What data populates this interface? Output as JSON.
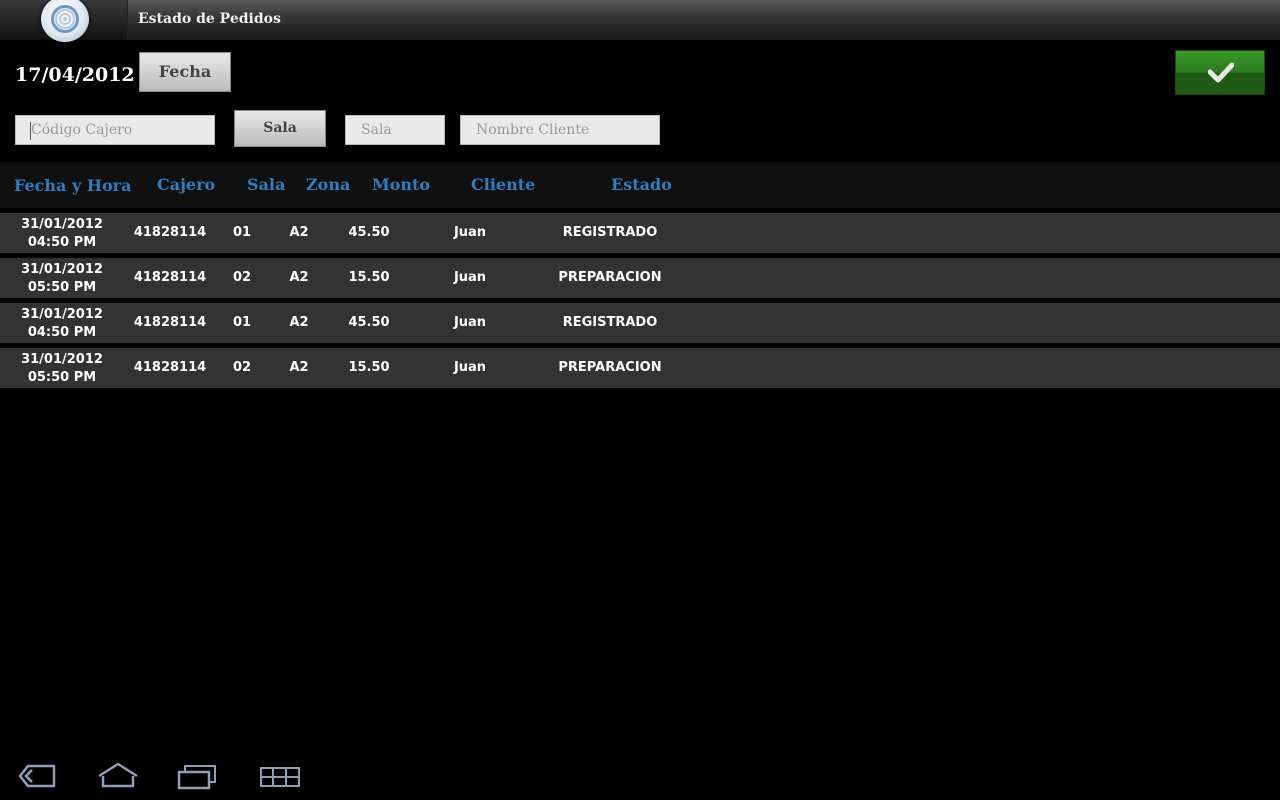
{
  "app": {
    "title": "Estado de Pedidos",
    "logo_icon": "app-logo-icon"
  },
  "filters": {
    "date_value": "17/04/2012",
    "fecha_button": "Fecha",
    "sala_button": "Sala",
    "cajero_placeholder": "Código Cajero",
    "sala_placeholder": "Sala",
    "cliente_placeholder": "Nombre Cliente",
    "confirm_icon": "checkmark-icon",
    "accent_color": "#2a7a1d"
  },
  "table": {
    "headers": [
      "Fecha y Hora",
      "Cajero",
      "Sala",
      "Zona",
      "Monto",
      "Cliente",
      "Estado"
    ],
    "header_color": "#2d7fc1",
    "rows": [
      {
        "date": "31/01/2012",
        "time": "04:50 PM",
        "cajero": "41828114",
        "sala": "01",
        "zona": "A2",
        "monto": "45.50",
        "cliente": "Juan",
        "estado": "REGISTRADO"
      },
      {
        "date": "31/01/2012",
        "time": "05:50 PM",
        "cajero": "41828114",
        "sala": "02",
        "zona": "A2",
        "monto": "15.50",
        "cliente": "Juan",
        "estado": "PREPARACION"
      },
      {
        "date": "31/01/2012",
        "time": "04:50 PM",
        "cajero": "41828114",
        "sala": "01",
        "zona": "A2",
        "monto": "45.50",
        "cliente": "Juan",
        "estado": "REGISTRADO"
      },
      {
        "date": "31/01/2012",
        "time": "05:50 PM",
        "cajero": "41828114",
        "sala": "02",
        "zona": "A2",
        "monto": "15.50",
        "cliente": "Juan",
        "estado": "PREPARACION"
      }
    ]
  },
  "navbar": {
    "icons": [
      "back-icon",
      "home-icon",
      "recent-apps-icon",
      "menu-grid-icon"
    ]
  }
}
